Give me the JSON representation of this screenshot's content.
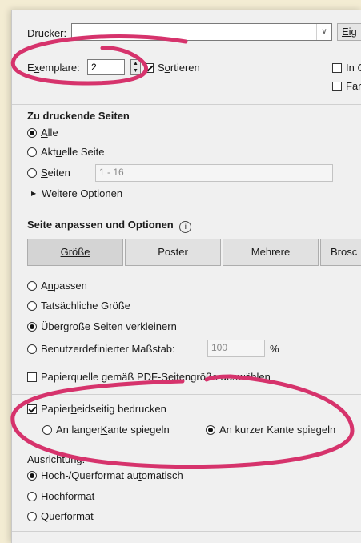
{
  "printer": {
    "label_pre": "Dru",
    "label_u": "c",
    "label_post": "ker:",
    "value": "",
    "properties_button": "Eig"
  },
  "copies": {
    "label_pre": "E",
    "label_u": "x",
    "label_post": "emplare:",
    "value": "2",
    "collate_pre": "S",
    "collate_u": "o",
    "collate_post": "rtieren",
    "right_opt1": "In C",
    "right_opt2": "Far"
  },
  "pages_section": {
    "title": "Zu druckende Seiten",
    "all_u": "A",
    "all_post": "lle",
    "current_pre": "Akt",
    "current_u": "u",
    "current_post": "elle Seite",
    "pages_u": "S",
    "pages_post": "eiten",
    "pages_value": "1 - 16",
    "more": "Weitere Optionen"
  },
  "fit_section": {
    "title": "Seite anpassen und Optionen",
    "info_icon": "i",
    "tabs": [
      "Größe",
      "Poster",
      "Mehrere",
      "Brosc"
    ],
    "fit_pre": "A",
    "fit_u": "n",
    "fit_post": "passen",
    "actual_size": "Tatsächliche Größe",
    "shrink": "Übergroße Seiten verkleinern",
    "custom_scale": "Benutzerdefinierter Maßstab:",
    "scale_value": "100",
    "scale_unit": "%",
    "paper_source_pre": "Papierquelle gemäß P",
    "paper_source_u": "D",
    "paper_source_post": "F-Seitengröße auswählen"
  },
  "duplex": {
    "label_pre": "Papier ",
    "label_u": "b",
    "label_post": "eidseitig bedrucken",
    "long_pre": "An langer ",
    "long_u": "K",
    "long_post": "ante spiegeln",
    "short": "An kurzer Kante spiegeln"
  },
  "orientation": {
    "title": "Ausrichtung:",
    "auto_pre": "Hoch-/Querformat au",
    "auto_u": "t",
    "auto_post": "omatisch",
    "portrait": "Hochformat",
    "landscape": "Querformat"
  },
  "colors": {
    "annotation": "#d6336c",
    "dialog_bg": "#f0f0f0",
    "page_bg": "#f3ecd3"
  }
}
